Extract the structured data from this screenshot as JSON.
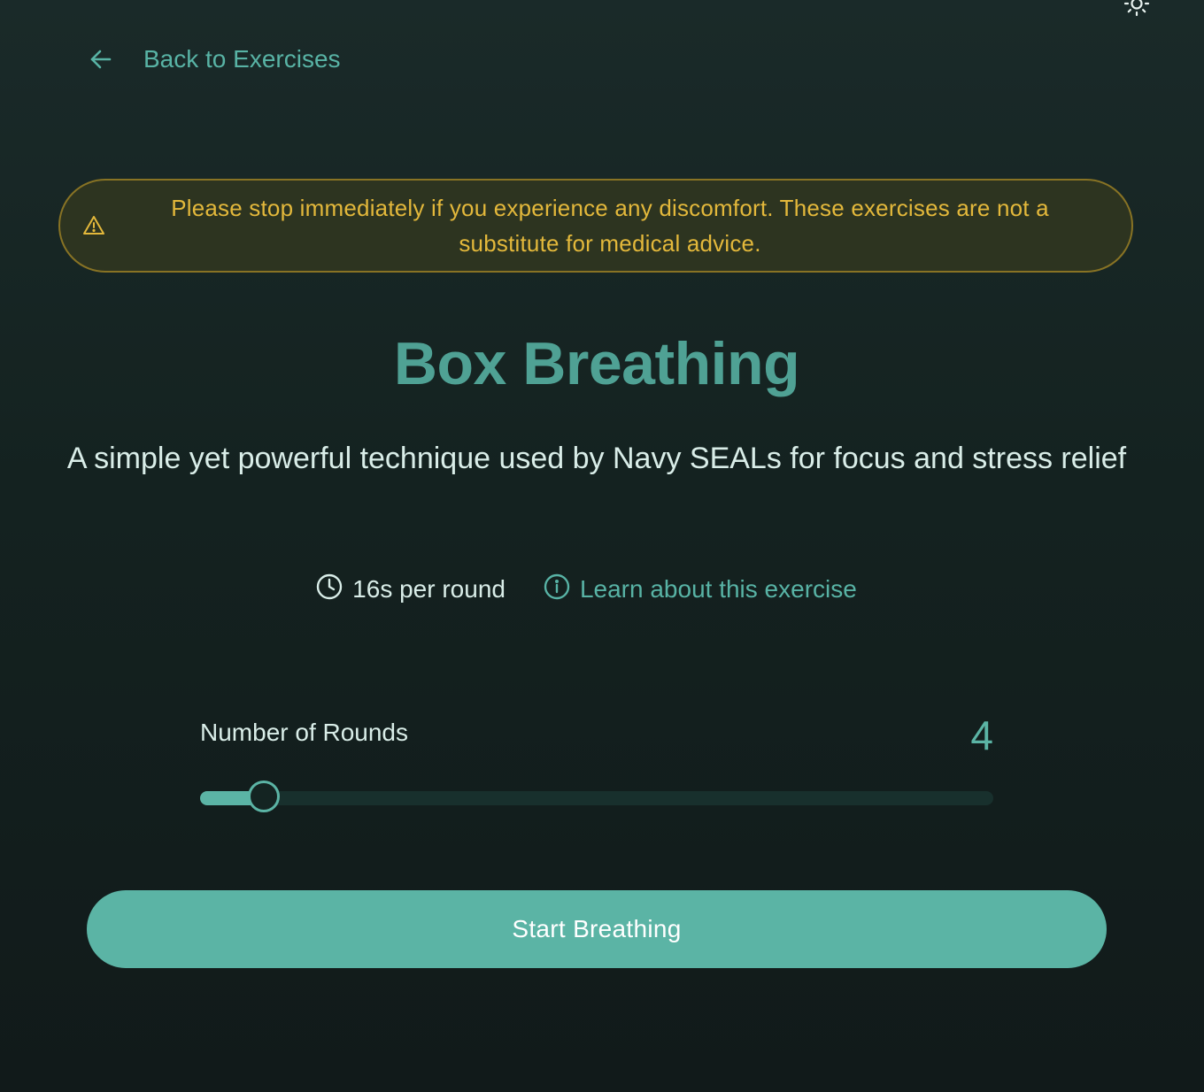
{
  "header": {
    "back_label": "Back to Exercises",
    "back_icon": "arrow-left-icon",
    "theme_icon": "sun-icon"
  },
  "disclaimer": {
    "icon": "warning-triangle-icon",
    "text": "Please stop immediately if you experience any discomfort. These exercises are not a substitute for medical advice."
  },
  "exercise": {
    "title": "Box Breathing",
    "description": "A simple yet powerful technique used by Navy SEALs for focus and stress relief",
    "duration_icon": "clock-icon",
    "duration_text": "16s per round",
    "learn_icon": "info-circle-icon",
    "learn_label": "Learn about this exercise"
  },
  "rounds": {
    "label": "Number of Rounds",
    "value": "4",
    "slider_fraction": 0.08
  },
  "actions": {
    "start_label": "Start Breathing"
  },
  "colors": {
    "accent": "#5bb4a5",
    "title": "#4fa194",
    "warning_text": "#e3b83b",
    "warning_border": "#887324",
    "background": "#142220"
  }
}
